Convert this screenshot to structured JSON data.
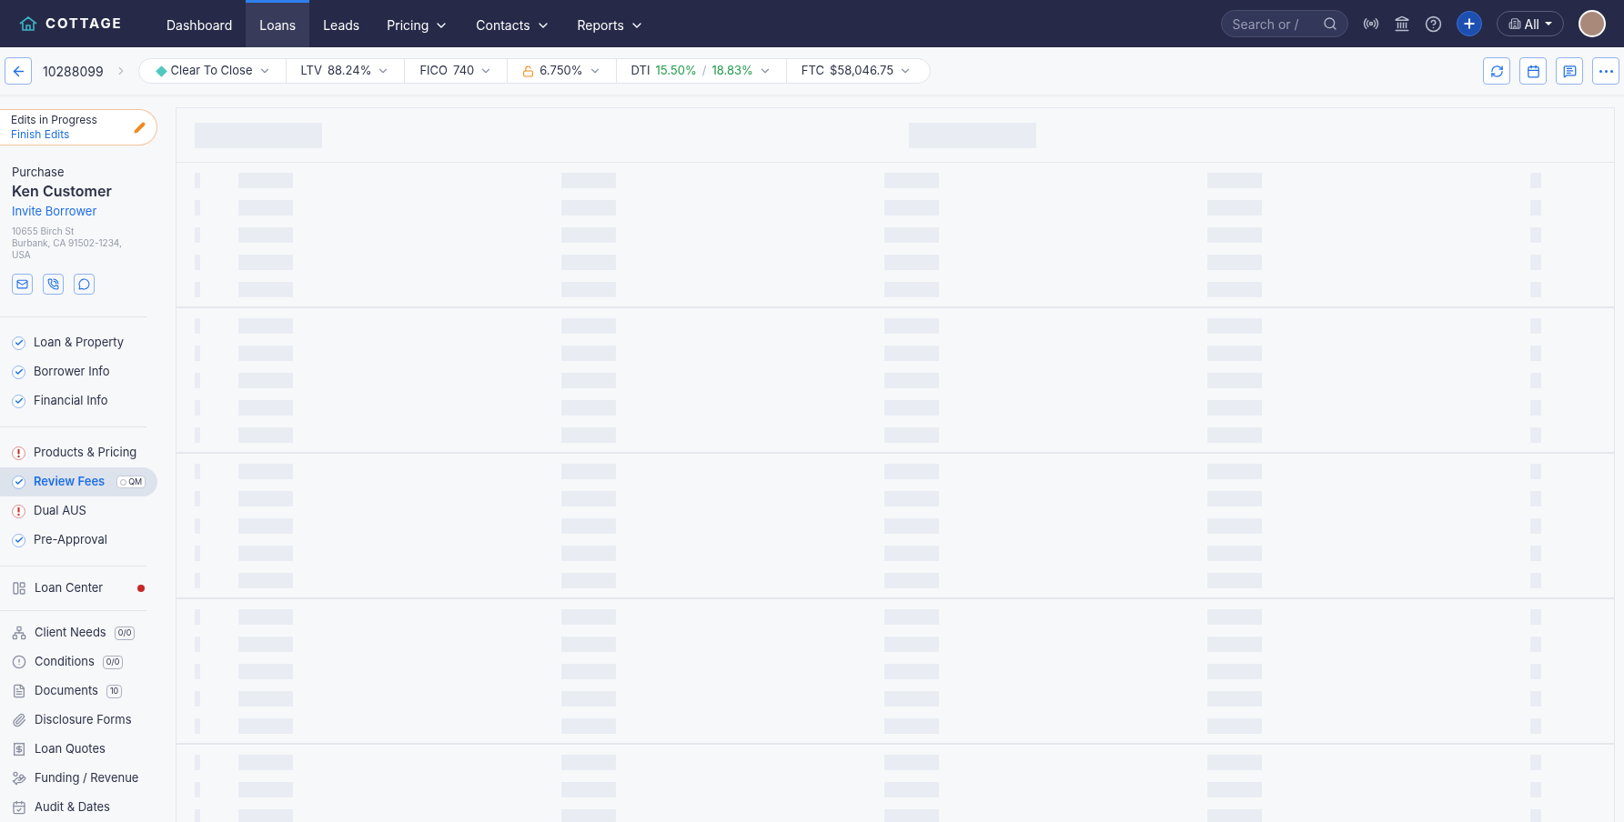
{
  "nav": {
    "logo": "COTTAGE",
    "items": [
      {
        "label": "Dashboard",
        "selected": false,
        "dropdown": false
      },
      {
        "label": "Loans",
        "selected": true,
        "dropdown": false
      },
      {
        "label": "Leads",
        "selected": false,
        "dropdown": false
      },
      {
        "label": "Pricing",
        "selected": false,
        "dropdown": true
      },
      {
        "label": "Contacts",
        "selected": false,
        "dropdown": true
      },
      {
        "label": "Reports",
        "selected": false,
        "dropdown": true
      }
    ],
    "search": {
      "placeholder": "Search or /"
    },
    "org_filter": "All"
  },
  "loan_bar": {
    "loan_number": "10288099",
    "pills": [
      {
        "kind": "status",
        "value": "Clear To Close"
      },
      {
        "kind": "metric",
        "label": "LTV",
        "value": "88.24%"
      },
      {
        "kind": "metric",
        "label": "FICO",
        "value": "740"
      },
      {
        "kind": "rate",
        "value": "6.750%"
      },
      {
        "kind": "dti",
        "label": "DTI",
        "value": "15.50%",
        "separator": "/",
        "value2": "18.83%"
      },
      {
        "kind": "metric",
        "label": "FTC",
        "value": "$58,046.75"
      }
    ]
  },
  "sidebar": {
    "edits": {
      "title": "Edits in Progress",
      "link": "Finish Edits"
    },
    "loan_purpose": "Purchase",
    "borrower": "Ken Customer",
    "invite_link": "Invite Borrower",
    "address": [
      "10655 Birch St",
      "Burbank, CA 91502-1234,",
      "USA"
    ],
    "step_groups": [
      [
        {
          "label": "Loan & Property",
          "kind": "done",
          "selected": false
        },
        {
          "label": "Borrower Info",
          "kind": "done",
          "selected": false
        },
        {
          "label": "Financial Info",
          "kind": "done",
          "selected": false
        }
      ],
      [
        {
          "label": "Products & Pricing",
          "kind": "alert",
          "selected": false
        },
        {
          "label": "Review Fees",
          "kind": "done",
          "selected": true,
          "badge": "QM"
        },
        {
          "label": "Dual AUS",
          "kind": "alert",
          "selected": false
        },
        {
          "label": "Pre-Approval",
          "kind": "done",
          "selected": false
        }
      ]
    ],
    "loan_center": {
      "label": "Loan Center",
      "alert": true
    },
    "tools": [
      {
        "label": "Client Needs",
        "kind": "needs",
        "count": "0/0"
      },
      {
        "label": "Conditions",
        "kind": "conditions",
        "count": "0/0"
      },
      {
        "label": "Documents",
        "kind": "documents",
        "count": "10"
      },
      {
        "label": "Disclosure Forms",
        "kind": "disclosures"
      },
      {
        "label": "Loan Quotes",
        "kind": "quotes"
      },
      {
        "label": "Funding / Revenue",
        "kind": "funding"
      },
      {
        "label": "Audit & Dates",
        "kind": "audit"
      }
    ]
  }
}
